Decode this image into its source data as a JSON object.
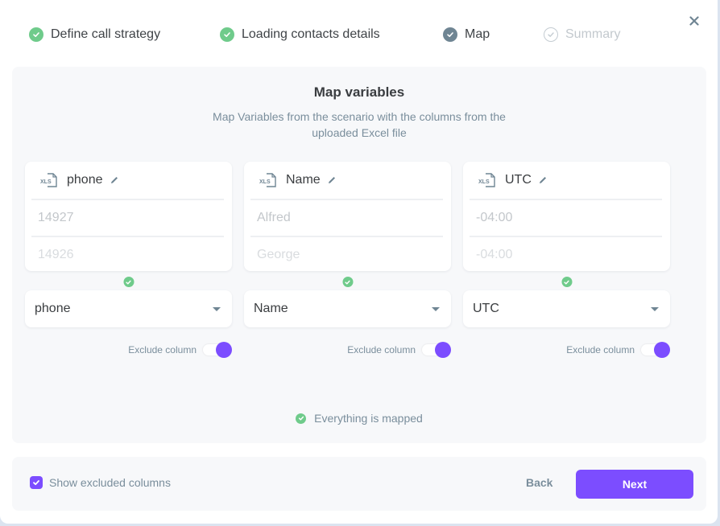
{
  "stepper": {
    "steps": [
      {
        "label": "Define call strategy",
        "state": "done",
        "icon": "check-circle-icon"
      },
      {
        "label": "Loading contacts details",
        "state": "done",
        "icon": "check-circle-icon"
      },
      {
        "label": "Map",
        "state": "current",
        "icon": "check-circle-icon"
      },
      {
        "label": "Summary",
        "state": "pending",
        "icon": "check-circle-outline-icon"
      }
    ],
    "close_icon": "close-icon"
  },
  "main": {
    "title": "Map variables",
    "subtitle": "Map Variables from the scenario with the columns from the uploaded Excel file",
    "columns": [
      {
        "name": "phone",
        "file_icon": "xls-file-icon",
        "values": [
          "14927",
          "14926"
        ],
        "mapped_to": "phone",
        "exclude_label": "Exclude column",
        "exclude_on": true
      },
      {
        "name": "Name",
        "file_icon": "xls-file-icon",
        "values": [
          "Alfred",
          "George"
        ],
        "mapped_to": "Name",
        "exclude_label": "Exclude column",
        "exclude_on": true
      },
      {
        "name": "UTC",
        "file_icon": "xls-file-icon",
        "values": [
          "-04:00",
          "-04:00"
        ],
        "mapped_to": "UTC",
        "exclude_label": "Exclude column",
        "exclude_on": true
      }
    ],
    "status": "Everything is mapped"
  },
  "footer": {
    "show_excluded_label": "Show excluded columns",
    "show_excluded_checked": true,
    "back_label": "Back",
    "next_label": "Next"
  },
  "colors": {
    "accent": "#7c4dff",
    "success": "#6fcb8b",
    "current_step": "#6f8593"
  }
}
